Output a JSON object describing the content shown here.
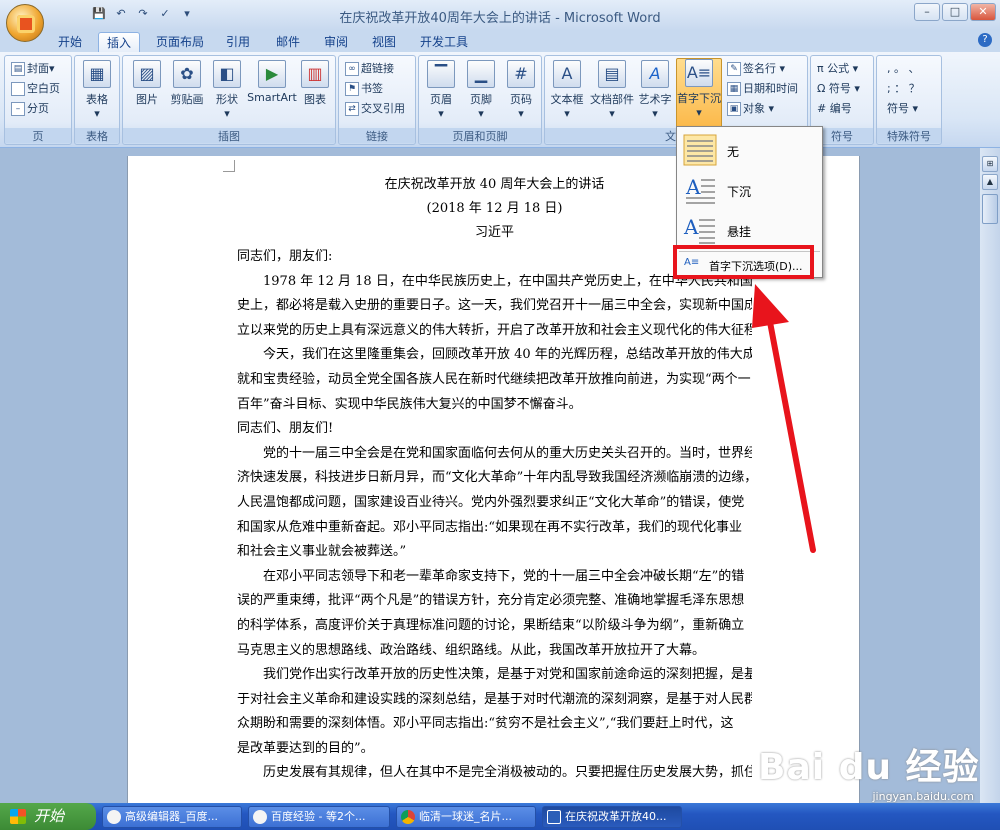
{
  "window": {
    "title": "在庆祝改革开放40周年大会上的讲话 - Microsoft Word",
    "min": "–",
    "max": "□",
    "close": "✕"
  },
  "qat": [
    "💾",
    "↶",
    "↷",
    "✓",
    "▾"
  ],
  "tabs": [
    "开始",
    "插入",
    "页面布局",
    "引用",
    "邮件",
    "审阅",
    "视图",
    "开发工具"
  ],
  "active_tab": "插入",
  "help": "?",
  "ribbon": {
    "pages": {
      "cover": "封面",
      "blank": "空白页",
      "break": "分页",
      "label": "页"
    },
    "table": {
      "table": "表格",
      "label": "表格"
    },
    "illustrations": {
      "picture": "图片",
      "clipart": "剪贴画",
      "shapes": "形状",
      "smartart": "SmartArt",
      "chart": "图表",
      "label": "插图"
    },
    "links": {
      "hyperlink": "超链接",
      "bookmark": "书签",
      "crossref": "交叉引用",
      "label": "链接"
    },
    "header_footer": {
      "header": "页眉",
      "footer": "页脚",
      "pagenum": "页码",
      "label": "页眉和页脚"
    },
    "text": {
      "textbox": "文本框",
      "quickparts": "文档部件",
      "wordart": "艺术字",
      "dropcap": "首字下沉",
      "signature": "签名行",
      "datetime": "日期和时间",
      "object": "对象",
      "label": "文"
    },
    "symbols": {
      "equation": "π 公式",
      "symbol": "Ω 符号",
      "number": "# 编号",
      "label": "符号"
    },
    "special": {
      "row1": ", 。 、",
      "row2": "; ： ？",
      "row3": "符号",
      "label": "特殊符号"
    }
  },
  "dropcap_menu": {
    "none": "无",
    "dropped": "下沉",
    "margin": "悬挂",
    "options": "首字下沉选项(D)..."
  },
  "document": {
    "title": "在庆祝改革开放 40 周年大会上的讲话",
    "date": "(2018 年 12 月 18 日)",
    "author": "习近平",
    "lines": [
      {
        "t": "同志们，朋友们:",
        "i": false
      },
      {
        "t": "1978 年 12 月 18 日，在中华民族历史上，在中国共产党历史上，在中华人民共和国历",
        "i": true
      },
      {
        "t": "史上，都必将是载入史册的重要日子。这一天，我们党召开十一届三中全会，实现新中国成",
        "i": false
      },
      {
        "t": "立以来党的历史上具有深远意义的伟大转折，开启了改革开放和社会主义现代化的伟大征程。",
        "i": false
      },
      {
        "t": "今天，我们在这里隆重集会，回顾改革开放 40 年的光辉历程，总结改革开放的伟大成",
        "i": true
      },
      {
        "t": "就和宝贵经验，动员全党全国各族人民在新时代继续把改革开放推向前进，为实现“两个一",
        "i": false
      },
      {
        "t": "百年”奋斗目标、实现中华民族伟大复兴的中国梦不懈奋斗。",
        "i": false
      },
      {
        "t": "同志们、朋友们!",
        "i": false
      },
      {
        "t": "党的十一届三中全会是在党和国家面临何去何从的重大历史关头召开的。当时，世界经",
        "i": true
      },
      {
        "t": "济快速发展，科技进步日新月异，而“文化大革命”十年内乱导致我国经济濒临崩溃的边缘，",
        "i": false
      },
      {
        "t": "人民温饱都成问题，国家建设百业待兴。党内外强烈要求纠正“文化大革命”的错误，使党",
        "i": false
      },
      {
        "t": "和国家从危难中重新奋起。邓小平同志指出:“如果现在再不实行改革，我们的现代化事业",
        "i": false
      },
      {
        "t": "和社会主义事业就会被葬送。”",
        "i": false
      },
      {
        "t": "在邓小平同志领导下和老一辈革命家支持下，党的十一届三中全会冲破长期“左”的错",
        "i": true
      },
      {
        "t": "误的严重束缚，批评“两个凡是”的错误方针，充分肯定必须完整、准确地掌握毛泽东思想",
        "i": false
      },
      {
        "t": "的科学体系，高度评价关于真理标准问题的讨论，果断结束“以阶级斗争为纲”，重新确立",
        "i": false
      },
      {
        "t": "马克思主义的思想路线、政治路线、组织路线。从此，我国改革开放拉开了大幕。",
        "i": false
      },
      {
        "t": "我们党作出实行改革开放的历史性决策，是基于对党和国家前途命运的深刻把握，是基",
        "i": true
      },
      {
        "t": "于对社会主义革命和建设实践的深刻总结，是基于对时代潮流的深刻洞察，是基于对人民群",
        "i": false
      },
      {
        "t": "众期盼和需要的深刻体悟。邓小平同志指出:“贫穷不是社会主义”,“我们要赶上时代，这",
        "i": false
      },
      {
        "t": "是改革要达到的目的”。",
        "i": false
      },
      {
        "t": "历史发展有其规律，但人在其中不是完全消极被动的。只要把握住历史发展大势，抓住",
        "i": true
      }
    ]
  },
  "taskbar": {
    "start": "开始",
    "tasks": [
      "高级编辑器_百度...",
      "百度经验 - 等2个...",
      "临清一球迷_名片...",
      "在庆祝改革开放40..."
    ]
  },
  "watermark": {
    "brand": "Bai du 经验",
    "url": "jingyan.baidu.com"
  }
}
